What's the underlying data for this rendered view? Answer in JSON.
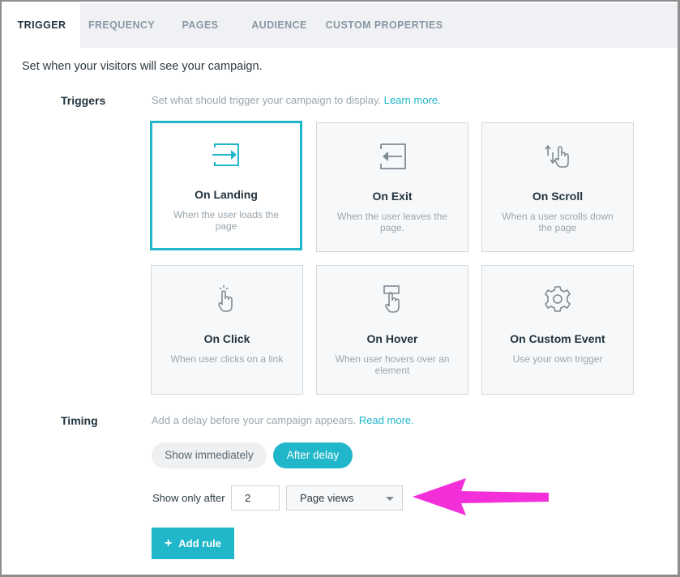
{
  "tabs": [
    {
      "label": "TRIGGER"
    },
    {
      "label": "FREQUENCY"
    },
    {
      "label": "PAGES"
    },
    {
      "label": "AUDIENCE"
    },
    {
      "label": "CUSTOM PROPERTIES"
    }
  ],
  "intro": "Set when your visitors will see your campaign.",
  "triggers": {
    "label": "Triggers",
    "hint": "Set what should trigger your campaign to display.",
    "hint_link": "Learn more.",
    "cards": [
      {
        "title": "On Landing",
        "desc": "When the user loads the page",
        "icon": "enter-icon"
      },
      {
        "title": "On Exit",
        "desc": "When the user leaves the page.",
        "icon": "exit-icon"
      },
      {
        "title": "On Scroll",
        "desc": "When a user scrolls down the page",
        "icon": "scroll-hand-icon"
      },
      {
        "title": "On Click",
        "desc": "When user clicks on a link",
        "icon": "click-hand-icon"
      },
      {
        "title": "On Hover",
        "desc": "When user hovers over an element",
        "icon": "hover-hand-icon"
      },
      {
        "title": "On Custom Event",
        "desc": "Use your own trigger",
        "icon": "gear-icon"
      }
    ]
  },
  "timing": {
    "label": "Timing",
    "hint": "Add a delay before your campaign appears.",
    "hint_link": "Read more.",
    "show_immediately": "Show immediately",
    "after_delay": "After delay",
    "show_only_after": "Show only after",
    "delay_value": "2",
    "delay_unit": "Page views",
    "add_rule": "Add rule"
  },
  "colors": {
    "accent": "#1fb7c9",
    "annotation_arrow": "#f22fd9"
  }
}
